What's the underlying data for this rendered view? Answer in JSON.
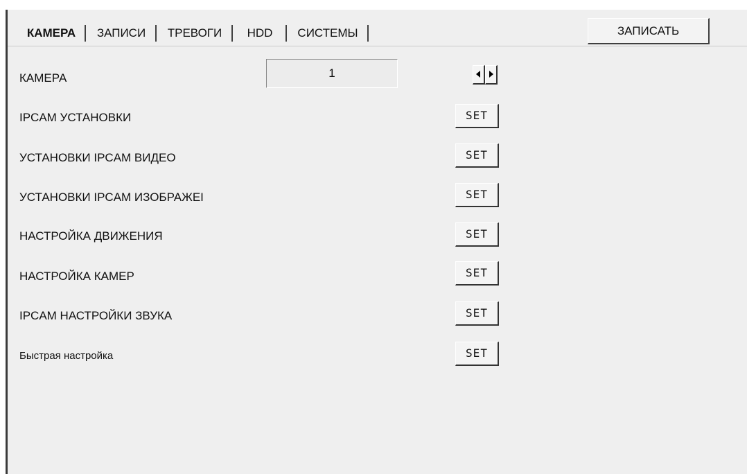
{
  "tabs": [
    {
      "label": "КАМЕРА",
      "active": true
    },
    {
      "label": "ЗАПИСИ",
      "active": false
    },
    {
      "label": "ТРЕВОГИ",
      "active": false
    },
    {
      "label": "HDD",
      "active": false
    },
    {
      "label": "СИСТЕМЫ",
      "active": false
    }
  ],
  "toolbar": {
    "write_label": "ЗАПИСАТЬ"
  },
  "camera": {
    "label": "КАМЕРА",
    "value": "1",
    "prev_icon": "arrow-left-icon",
    "next_icon": "arrow-right-icon"
  },
  "settings": [
    {
      "label": "IPCAM УСТАНОВКИ",
      "button": "SET"
    },
    {
      "label": "УСТАНОВКИ IPCAM ВИДЕО",
      "button": "SET"
    },
    {
      "label": "УСТАНОВКИ IPCAM ИЗОБРАЖЕI",
      "button": "SET"
    },
    {
      "label": "НАСТРОЙКА ДВИЖЕНИЯ",
      "button": "SET"
    },
    {
      "label": "НАСТРОЙКА КАМЕР",
      "button": "SET"
    },
    {
      "label": "IPCAM НАСТРОЙКИ ЗВУКА",
      "button": "SET"
    },
    {
      "label": "Быстрая настройка",
      "button": "SET"
    }
  ],
  "colors": {
    "panel": "#efefef",
    "border_dark": "#333333",
    "text": "#111111"
  }
}
